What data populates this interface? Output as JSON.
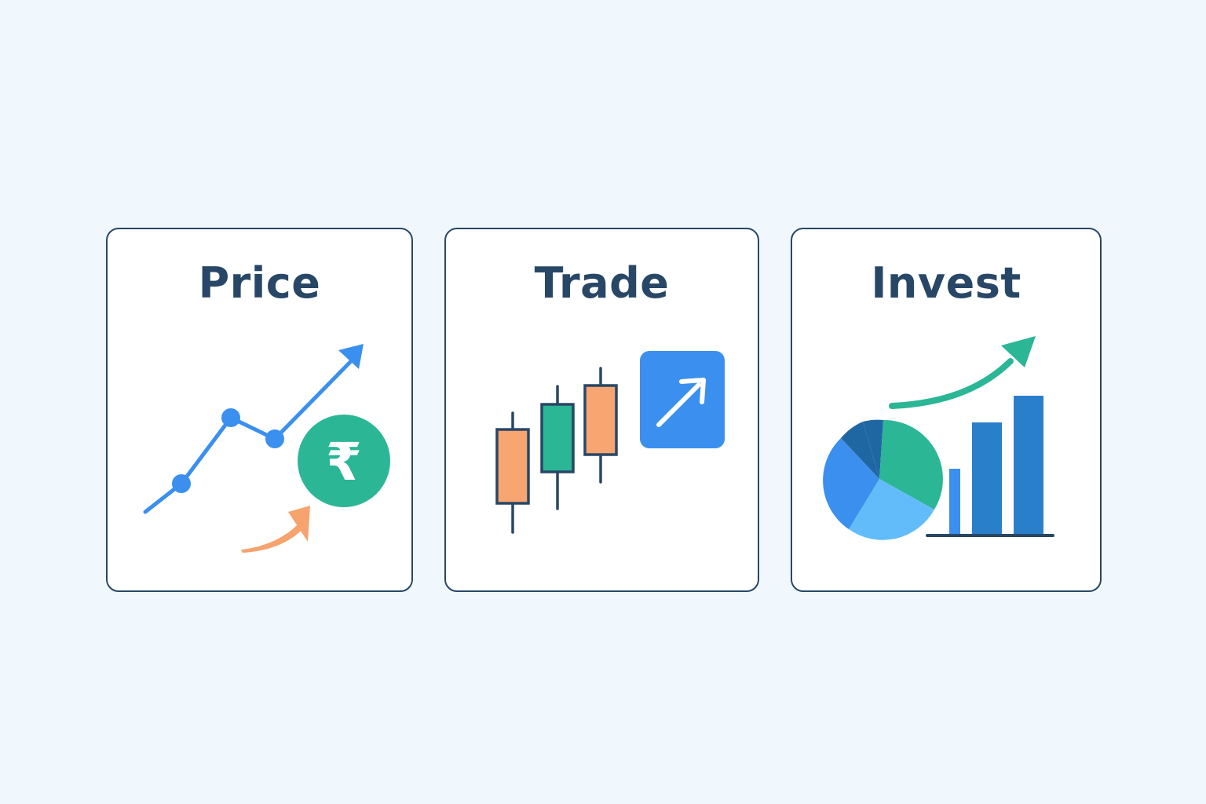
{
  "cards": [
    {
      "title": "Price",
      "icon": "rising-line-chart-with-rupee-coin",
      "symbol": "₹",
      "colors": {
        "line": "#3b8fee",
        "coin": "#2bb696",
        "arrow": "#f6a36e"
      }
    },
    {
      "title": "Trade",
      "icon": "candlestick-chart-with-growth-badge",
      "colors": {
        "bearish": "#f8a572",
        "bullish": "#2bb696",
        "badge": "#3b8fee",
        "outline": "#284766"
      }
    },
    {
      "title": "Invest",
      "icon": "pie-and-bar-chart-with-growth-arrow",
      "colors": {
        "arrow": "#2bb696",
        "bars": "#2a7fcb",
        "pie_teal": "#2bb696",
        "pie_blue": "#3b8fee",
        "pie_light": "#63bcfa",
        "pie_dark": "#1f67a3"
      }
    }
  ]
}
